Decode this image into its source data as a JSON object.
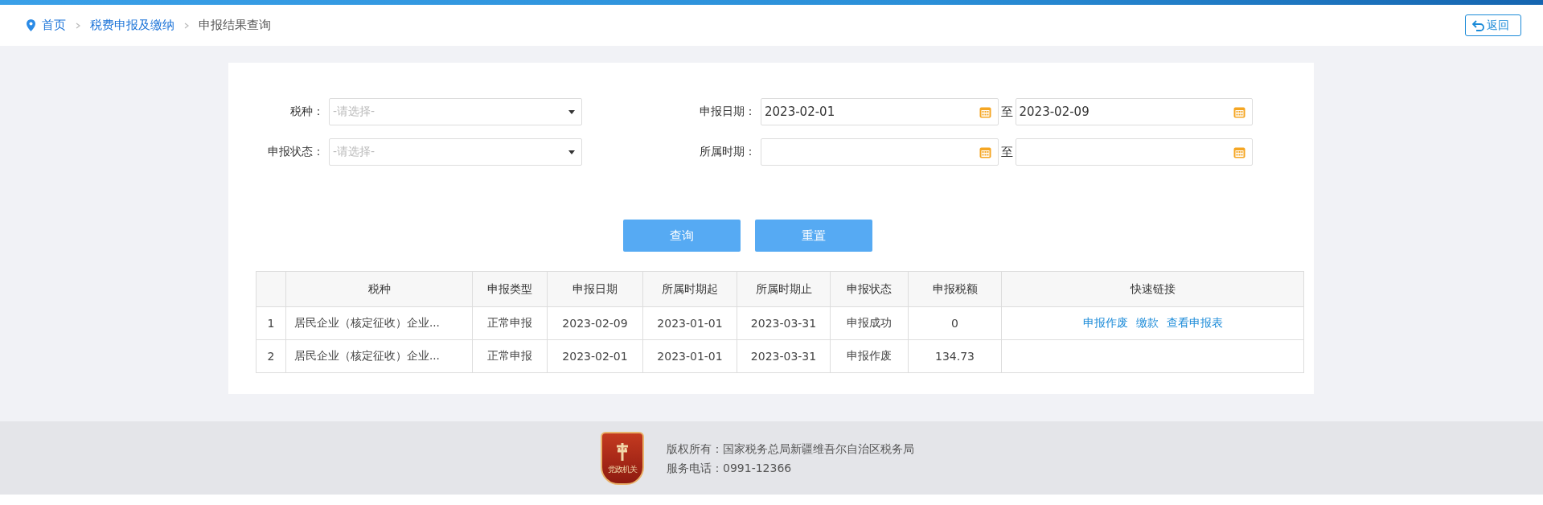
{
  "breadcrumb": [
    {
      "label": "首页",
      "kind": "home"
    },
    {
      "label": "税费申报及缴纳",
      "kind": "link"
    },
    {
      "label": "申报结果查询",
      "kind": "current"
    }
  ],
  "back_button": {
    "label": "返回"
  },
  "filters": [
    {
      "label": "税种：",
      "kind": "select",
      "placeholder": "-请选择-"
    },
    {
      "label": "申报日期：",
      "kind": "daterange",
      "from": "2023-02-01",
      "to_label": "至",
      "to": "2023-02-09"
    },
    {
      "label": "申报状态：",
      "kind": "select",
      "placeholder": "-请选择-"
    },
    {
      "label": "所属时期：",
      "kind": "daterange",
      "to_label": "至"
    }
  ],
  "buttons": [
    {
      "label": "查询"
    },
    {
      "label": "重置"
    }
  ],
  "table": {
    "columns": [
      "",
      "税种",
      "申报类型",
      "申报日期",
      "所属时期起",
      "所属时期止",
      "申报状态",
      "申报税额",
      "快速链接"
    ],
    "rows": [
      {
        "cells": [
          "1",
          "居民企业（核定征收）企业...",
          "正常申报",
          "2023-02-09",
          "2023-01-01",
          "2023-03-31",
          "申报成功",
          "0"
        ],
        "links": [
          "申报作废",
          "缴款",
          "查看申报表"
        ]
      },
      {
        "cells": [
          "2",
          "居民企业（核定征收）企业...",
          "正常申报",
          "2023-02-01",
          "2023-01-01",
          "2023-03-31",
          "申报作废",
          "134.73"
        ],
        "links": []
      }
    ]
  },
  "footer": {
    "badge_text": "党政机关",
    "lines": [
      "版权所有：国家税务总局新疆维吾尔自治区税务局",
      "服务电话：0991-12366"
    ]
  }
}
